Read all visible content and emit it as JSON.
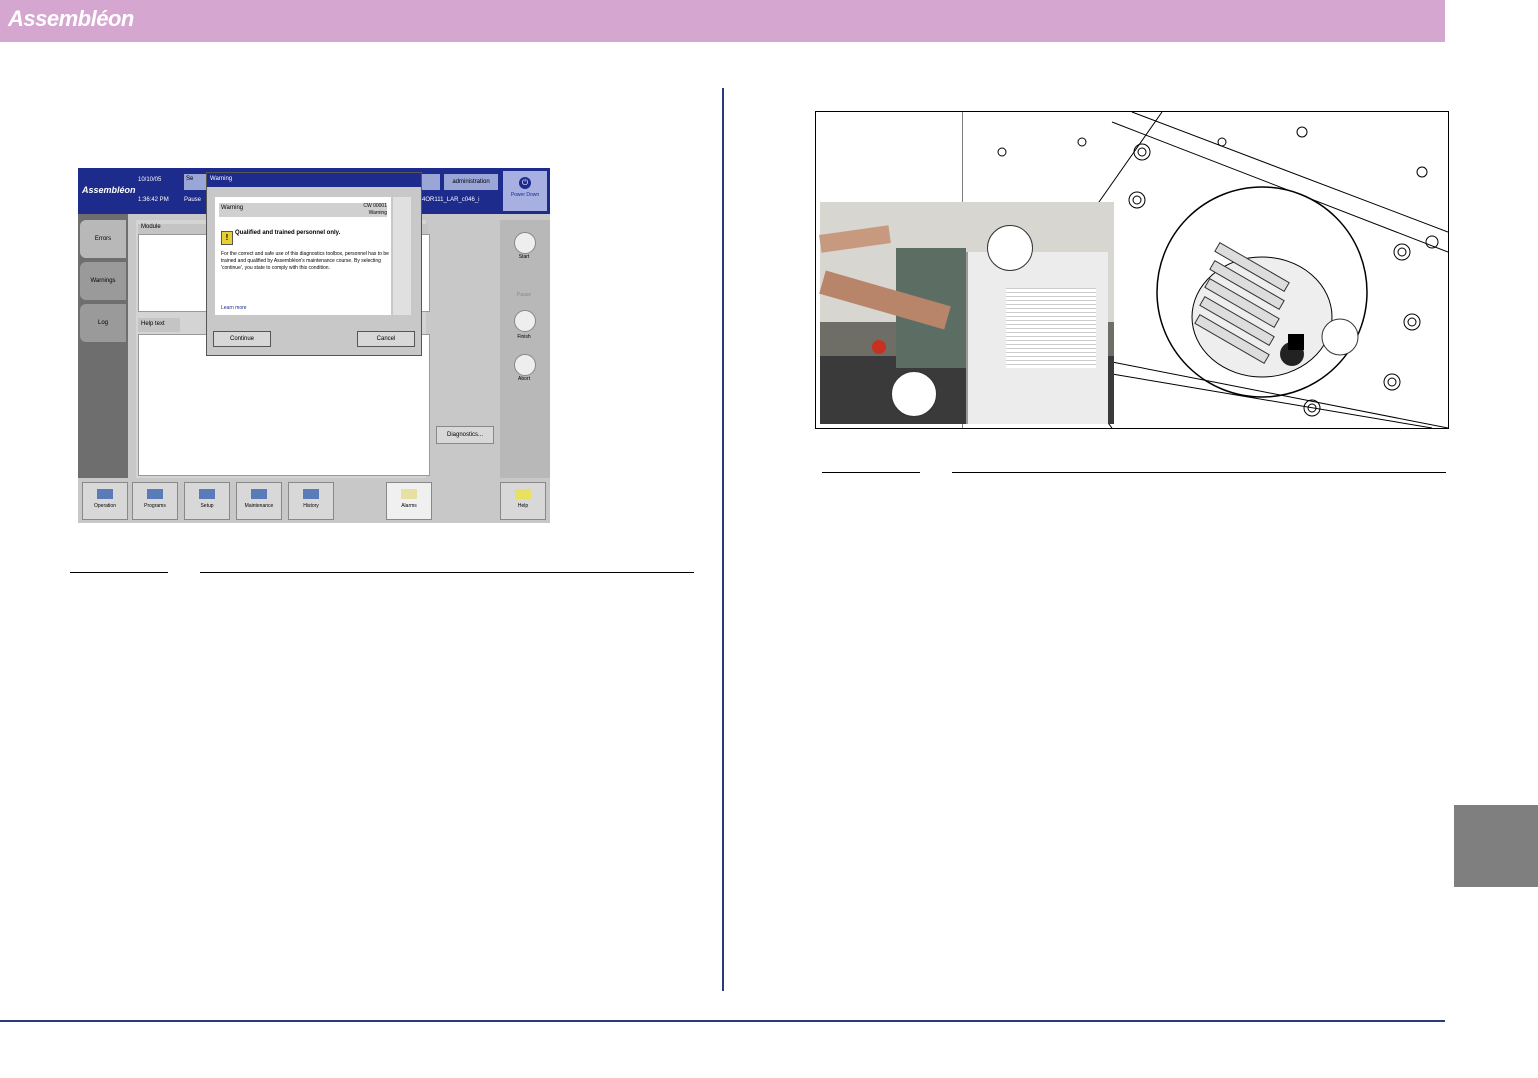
{
  "header": {
    "brand": "Assembléon",
    "color": "#d4a6d0"
  },
  "screenshot": {
    "brand": "Assembléon",
    "date": "10/10/05",
    "time": "1:36:42 PM",
    "status": "Pause",
    "se_button": "Se",
    "admin_button": "administration",
    "program": "4OR111_LAR_c046_i",
    "power_down": "Power Down",
    "left_tabs": [
      "Errors",
      "Warnings",
      "Log"
    ],
    "module_header": "Module",
    "help_header": "Help text",
    "diagnostics_button": "Diagnostics...",
    "right_buttons": [
      "Start",
      "Pause",
      "Finish",
      "Abort"
    ],
    "bottom_buttons": [
      "Operation",
      "Programs",
      "Setup",
      "Maintenance",
      "History",
      "Alarms",
      "Help"
    ],
    "dialog": {
      "title": "Warning",
      "heading": "Warning",
      "code": "CW 00001 Warning",
      "bold_text": "Qualified and trained personnel only.",
      "body": "For the correct and safe use of this diagnostics toolbox, personnel has to be trained and qualified by Assembléon's maintenance course. By selecting 'continue', you state to comply with this condition.",
      "link": "Learn more",
      "continue": "Continue",
      "cancel": "Cancel"
    }
  }
}
